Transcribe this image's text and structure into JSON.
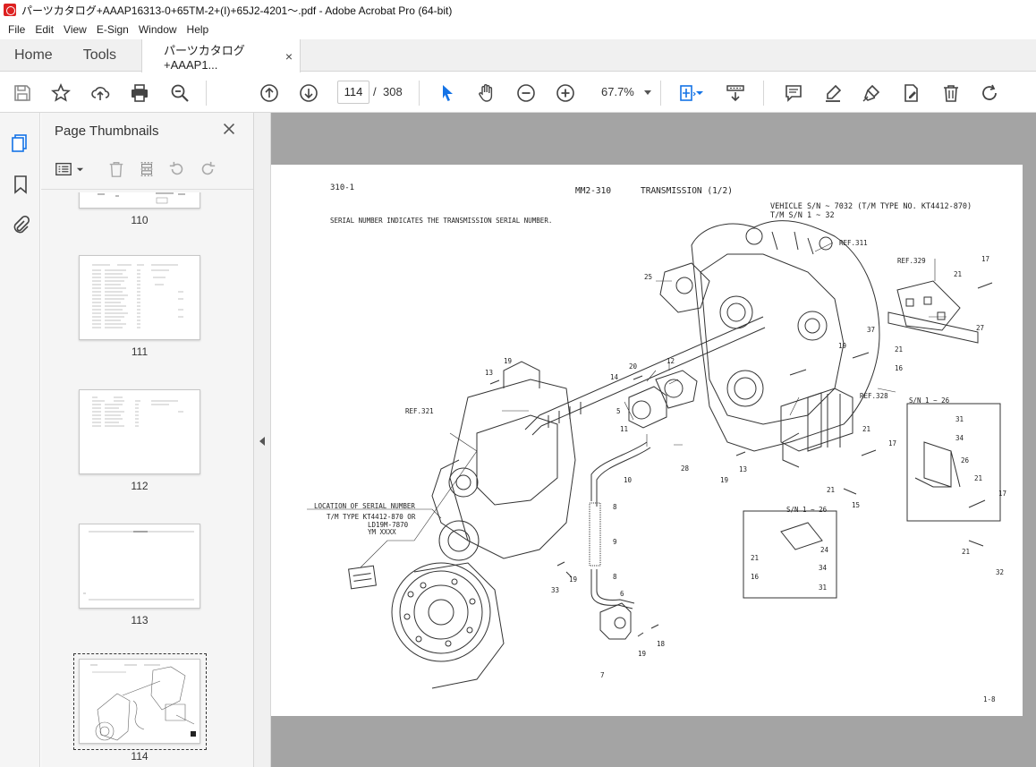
{
  "window": {
    "title": "パーツカタログ+AAAP16313-0+65TM-2+(I)+65J2-4201〜.pdf - Adobe Acrobat Pro (64-bit)"
  },
  "menu": [
    "File",
    "Edit",
    "View",
    "E-Sign",
    "Window",
    "Help"
  ],
  "tabs": {
    "home": "Home",
    "tools": "Tools",
    "document": "パーツカタログ+AAAP1...",
    "close_glyph": "×"
  },
  "toolbar": {
    "current_page": "114",
    "page_separator": "/",
    "total_pages": "308",
    "zoom": "67.7%"
  },
  "thumbnails_panel": {
    "title": "Page Thumbnails",
    "pages": [
      {
        "label": "110"
      },
      {
        "label": "111"
      },
      {
        "label": "112"
      },
      {
        "label": "113"
      },
      {
        "label": "114",
        "selected": true
      }
    ]
  },
  "document_page": {
    "section": "310-1",
    "model": "MM2-310",
    "title": "TRANSMISSION (1/2)",
    "vehicle_sn": "VEHICLE S/N ~ 7032 (T/M TYPE NO. KT4412-870)",
    "tm_sn": "T/M S/N 1 ~ 32",
    "serial_note": "SERIAL NUMBER INDICATES THE TRANSMISSION SERIAL NUMBER.",
    "ref_labels": [
      "REF.311",
      "REF.329",
      "REF.328",
      "REF.321"
    ],
    "sn_labels": [
      "S/N 1 ~ 26",
      "S/N 1 ~ 26"
    ],
    "serial_location": {
      "heading": "LOCATION OF SERIAL NUMBER",
      "line1": "T/M TYPE KT4412-870 OR",
      "line2": "LD19M-7870",
      "line3": "YM XXXX"
    },
    "callouts": [
      "25",
      "21",
      "17",
      "27",
      "19",
      "37",
      "21",
      "16",
      "13",
      "19",
      "14",
      "20",
      "12",
      "5",
      "11",
      "28",
      "10",
      "19",
      "13",
      "21",
      "17",
      "21",
      "15",
      "31",
      "34",
      "26",
      "21",
      "17",
      "8",
      "9",
      "8",
      "6",
      "33",
      "19",
      "24",
      "21",
      "16",
      "34",
      "31",
      "21",
      "32",
      "19",
      "18",
      "7"
    ],
    "page_number": "1-8"
  }
}
